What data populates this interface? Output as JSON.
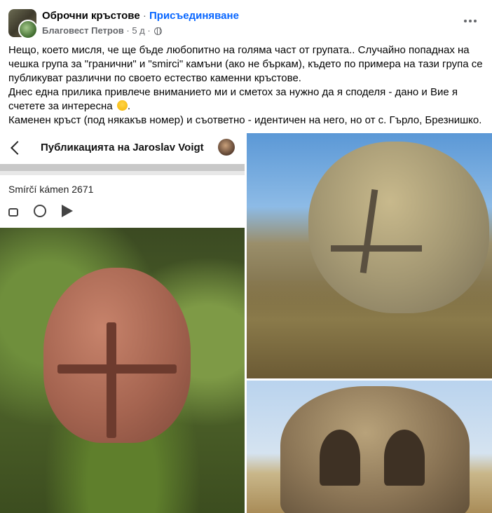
{
  "header": {
    "group_name": "Оброчни кръстове",
    "separator": "·",
    "join_label": "Присъединяване",
    "author": "Благовест Петров",
    "time": "5 д",
    "meta_sep": "·"
  },
  "post": {
    "lines": [
      "Нещо, което мисля, че ще бъде любопитно на голяма част от групата.. Случайно попаднах на чешка група за \"гранични\" и \"smirci\" камъни (ако не бъркам), където по примера на тази група се публикуват различни по своето естество каменни кръстове.",
      "Днес една прилика привлече вниманието ми и сметох за нужно да я споделя - дано и Вие я счетете за интересна",
      "Каменен кръст (под някакъв номер) и съответно - идентичен на него, но от с. Гърло, Брезнишко."
    ],
    "emoji_end": "."
  },
  "embedded": {
    "title": "Публикацията на Jaroslav Voigt",
    "caption": "Smírčí kámen 2671"
  },
  "icons": {
    "more": "more-horizontal-icon",
    "globe": "globe-icon",
    "back": "back-arrow-icon",
    "like": "like-icon",
    "comment": "comment-icon",
    "share": "share-icon",
    "emoji": "smile-emoji-icon"
  },
  "colors": {
    "accent": "#0866ff",
    "secondary_text": "#65676b"
  }
}
